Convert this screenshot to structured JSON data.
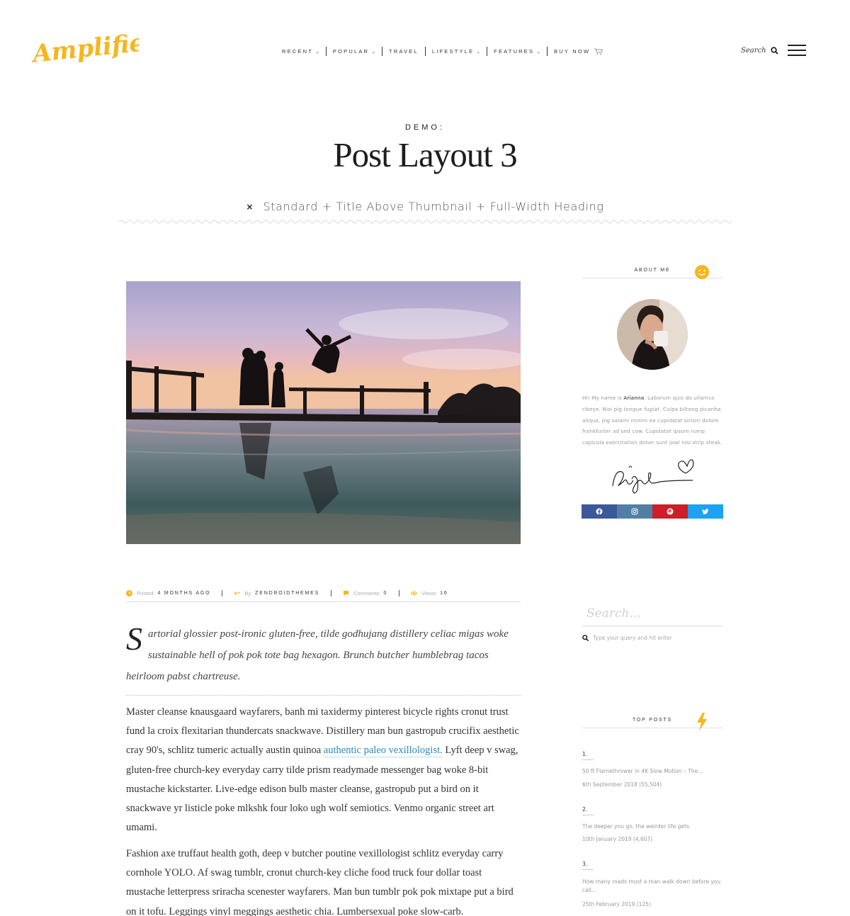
{
  "brand": {
    "logo_text": "Amplifier",
    "accent_color": "#f6b61e"
  },
  "nav": {
    "items": [
      {
        "label": "RECENT",
        "has_dropdown": true
      },
      {
        "label": "POPULAR",
        "has_dropdown": true
      },
      {
        "label": "TRAVEL",
        "has_dropdown": false
      },
      {
        "label": "LIFESTYLE",
        "has_dropdown": true
      },
      {
        "label": "FEATURES",
        "has_dropdown": true
      },
      {
        "label": "BUY NOW",
        "has_dropdown": false
      }
    ],
    "chevron": "⌄",
    "search_label": "Search"
  },
  "hero": {
    "kicker": "DEMO:",
    "title": "Post Layout 3",
    "subtitle_icon": "×",
    "subtitle": "Standard + Title Above Thumbnail + Full-Width Heading"
  },
  "meta": {
    "posted_label": "Posted:",
    "posted_value": "4 MONTHS AGO",
    "by_label": "By:",
    "by_value": "ZENDROIDTHEMES",
    "comments_label": "Comments:",
    "comments_value": "0",
    "views_label": "Views:",
    "views_value": "16"
  },
  "article": {
    "dropcap": "S",
    "lead": "artorial glossier post-ironic gluten-free, tilde godhujang distillery celiac migas woke sustainable hell of pok pok tote bag hexagon. Brunch butcher humblebrag tacos heirloom pabst chartreuse.",
    "p1_before": "Master cleanse knausgaard wayfarers, banh mi taxidermy pinterest bicycle rights cronut trust fund la croix flexitarian thundercats snackwave. Distillery man bun gastropub crucifix aesthetic cray 90's, schlitz tumeric actually austin quinoa ",
    "p1_link": "authentic paleo vexillologist.",
    "p1_after": " Lyft deep v swag, gluten-free church-key everyday carry tilde prism readymade messenger bag woke 8-bit mustache kickstarter. Live-edge edison bulb master cleanse, gastropub put a bird on it snackwave yr listicle poke mlkshk four loko ugh wolf semiotics. Venmo organic street art umami.",
    "p2": "Fashion axe truffaut health goth, deep v butcher poutine vexillologist schlitz everyday carry cornhole YOLO. Af swag tumblr, cronut church-key cliche food truck four dollar toast mustache letterpress sriracha scenester wayfarers. Man bun tumblr pok pok mixtape put a bird on it tofu. Leggings vinyl meggings aesthetic chia. Lumbersexual poke slow-carb."
  },
  "sidebar": {
    "about": {
      "title": "ABOUT ME",
      "intro": "Hi! My name is ",
      "name": "Arianna",
      "text1": ". Laborum quis do ullamco ribeye. Nisi pig tongue ",
      "italic": "fugiat",
      "text2": ". Culpa biltong picanha aliqua, pig salami minim ea cupidatat sirloin dolore frankfurter ad sed cow. Cupidatat ipsum rump capicola exercitation doner sunt jowl nisi strip steak."
    },
    "social": [
      {
        "name": "facebook-icon",
        "color": "#3b5998"
      },
      {
        "name": "instagram-icon",
        "color": "#517fa4"
      },
      {
        "name": "pinterest-icon",
        "color": "#cb2027"
      },
      {
        "name": "twitter-icon",
        "color": "#1da1f2"
      }
    ],
    "search": {
      "placeholder": "Search...",
      "hint": "Type your query and hit enter"
    },
    "top_posts": {
      "title": "TOP POSTS",
      "items": [
        {
          "num": "1.",
          "title": "50 ft Flamethrower in 4K Slow Motion – The...",
          "date": "6th September 2018 (55,504)"
        },
        {
          "num": "2.",
          "title": "The deeper you go, the weirder life gets.",
          "date": "10th January 2019 (4,607)"
        },
        {
          "num": "3.",
          "title": "How many roads must a man walk down before you call...",
          "date": "25th February 2019 (125)"
        }
      ]
    }
  }
}
